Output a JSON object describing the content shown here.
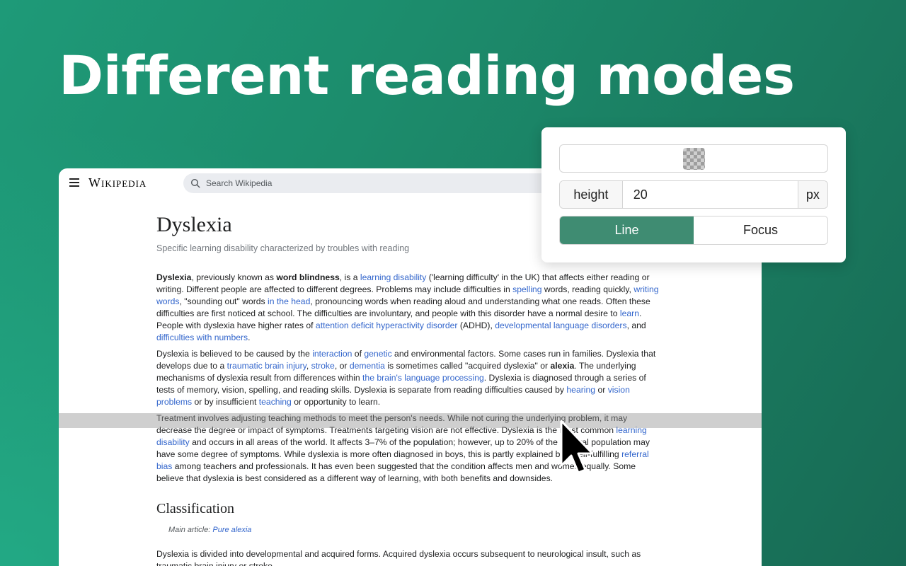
{
  "headline": "Different reading modes",
  "browser": {
    "wordmark": "Wikipedia",
    "search_placeholder": "Search Wikipedia"
  },
  "article": {
    "title": "Dyslexia",
    "subtitle": "Specific learning disability characterized by troubles with reading",
    "p1": [
      {
        "t": "Dyslexia",
        "k": "b"
      },
      {
        "t": ", previously known as ",
        "k": "t"
      },
      {
        "t": "word blindness",
        "k": "b"
      },
      {
        "t": ", is a ",
        "k": "t"
      },
      {
        "t": "learning disability",
        "k": "a"
      },
      {
        "t": " ('learning difficulty' in the UK) that affects either reading or writing. Different people are affected to different degrees. Problems may include difficulties in ",
        "k": "t"
      },
      {
        "t": "spelling",
        "k": "a"
      },
      {
        "t": " words, reading quickly, ",
        "k": "t"
      },
      {
        "t": "writing words",
        "k": "a"
      },
      {
        "t": ", \"sounding out\" words ",
        "k": "t"
      },
      {
        "t": "in the head",
        "k": "a"
      },
      {
        "t": ", pronouncing words when reading aloud and understanding what one reads. Often these difficulties are first noticed at school. The difficulties are involuntary, and people with this disorder have a normal desire to ",
        "k": "t"
      },
      {
        "t": "learn",
        "k": "a"
      },
      {
        "t": ". People with dyslexia have higher rates of ",
        "k": "t"
      },
      {
        "t": "attention deficit hyperactivity disorder",
        "k": "a"
      },
      {
        "t": " (ADHD), ",
        "k": "t"
      },
      {
        "t": "developmental language disorders",
        "k": "a"
      },
      {
        "t": ", and ",
        "k": "t"
      },
      {
        "t": "difficulties with numbers",
        "k": "a"
      },
      {
        "t": ".",
        "k": "t"
      }
    ],
    "p2": [
      {
        "t": "Dyslexia is believed to be caused by the ",
        "k": "t"
      },
      {
        "t": "interaction",
        "k": "a"
      },
      {
        "t": " of ",
        "k": "t"
      },
      {
        "t": "genetic",
        "k": "a"
      },
      {
        "t": " and environmental factors. Some cases run in families. Dyslexia that develops due to a ",
        "k": "t"
      },
      {
        "t": "traumatic brain injury",
        "k": "a"
      },
      {
        "t": ", ",
        "k": "t"
      },
      {
        "t": "stroke",
        "k": "a"
      },
      {
        "t": ", or ",
        "k": "t"
      },
      {
        "t": "dementia",
        "k": "a"
      },
      {
        "t": " is sometimes called \"acquired dyslexia\" or ",
        "k": "t"
      },
      {
        "t": "alexia",
        "k": "b"
      },
      {
        "t": ". The underlying mechanisms of dyslexia result from differences within ",
        "k": "t"
      },
      {
        "t": "the brain's language processing",
        "k": "a"
      },
      {
        "t": ". Dyslexia is diagnosed through a series of tests of memory, vision, spelling, and reading skills. Dyslexia is separate from reading difficulties caused by ",
        "k": "t"
      },
      {
        "t": "hearing",
        "k": "a"
      },
      {
        "t": " or ",
        "k": "t"
      },
      {
        "t": "vision problems",
        "k": "a"
      },
      {
        "t": " or by insufficient ",
        "k": "t"
      },
      {
        "t": "teaching",
        "k": "a"
      },
      {
        "t": " or opportunity to learn.",
        "k": "t"
      }
    ],
    "p3": [
      {
        "t": "Treatment involves adjusting teaching methods to meet the person's needs. While not curing the underlying problem, it may decrease the degree or impact of symptoms. Treatments targeting vision are not effective. Dyslexia is the most common ",
        "k": "t"
      },
      {
        "t": "learning disability",
        "k": "a"
      },
      {
        "t": " and occurs in all areas of the world. It affects 3–7% of the population; however, up to 20% of the general population may have some degree of symptoms. While dyslexia is more often diagnosed in boys, this is partly explained by a self-fulfilling ",
        "k": "t"
      },
      {
        "t": "referral bias",
        "k": "a"
      },
      {
        "t": " among teachers and professionals. It has even been suggested that the condition affects men and women equally. Some believe that dyslexia is best considered as a different way of learning, with both benefits and downsides.",
        "k": "t"
      }
    ],
    "section_heading": "Classification",
    "hatnote_prefix": "Main article: ",
    "hatnote_link": "Pure alexia",
    "p4": [
      {
        "t": "Dyslexia is divided into developmental and acquired forms. Acquired dyslexia occurs subsequent to neurological insult, such as traumatic brain injury or stroke.",
        "k": "t"
      }
    ]
  },
  "settings": {
    "color_swatch": "transparent",
    "height_label": "height",
    "height_value": "20",
    "unit": "px",
    "modes": [
      "Line",
      "Focus"
    ],
    "active_mode": "Line",
    "accent_color": "#3f8c72"
  },
  "colors": {
    "background": "#1b8a6b",
    "link": "#3366cc",
    "reading_line": "#8c8c8c"
  }
}
